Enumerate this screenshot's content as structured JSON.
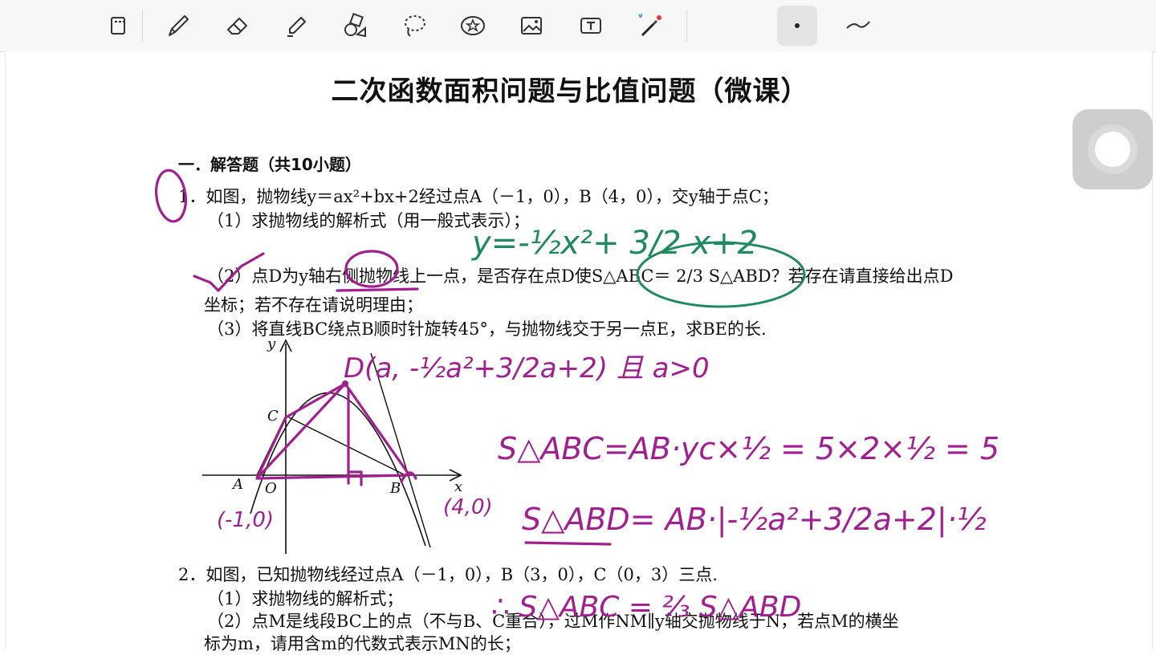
{
  "toolbar": {
    "tools": [
      {
        "name": "select-lasso-icon"
      },
      {
        "name": "pen-icon"
      },
      {
        "name": "eraser-icon"
      },
      {
        "name": "highlighter-icon"
      },
      {
        "name": "shapes-icon"
      },
      {
        "name": "lasso-icon"
      },
      {
        "name": "sticker-icon"
      },
      {
        "name": "image-icon"
      },
      {
        "name": "textbox-icon"
      },
      {
        "name": "laser-pointer-icon"
      },
      {
        "name": "dot-tool-icon"
      },
      {
        "name": "stroke-style-icon"
      }
    ],
    "active_tool": "dot-tool-icon"
  },
  "document": {
    "title": "二次函数面积问题与比值问题（微课）",
    "section": "一．解答题（共10小题）",
    "q1": {
      "stem": "1．如图，抛物线y＝ax²+bx+2经过点A（－1，0），B（4，0），交y轴于点C；",
      "p1": "（1）求抛物线的解析式（用一般式表示）；",
      "p2": "（2）点D为y轴右侧抛物线上一点，是否存在点D使S△ABC＝ 2/3 S△ABD？若存在请直接给出点D",
      "p2b": "坐标；若不存在请说明理由；",
      "p3": "（3）将直线BC绕点B顺时针旋转45°，与抛物线交于另一点E，求BE的长."
    },
    "figure": {
      "labels": {
        "y": "y",
        "x": "x",
        "C": "C",
        "A": "A",
        "O": "O",
        "B": "B"
      }
    },
    "q2": {
      "stem": "2．如图，已知抛物线经过点A（－1，0），B（3，0），C（0，3）三点.",
      "p1": "（1）求抛物线的解析式；",
      "p2": "（2）点M是线段BC上的点（不与B、C重合），过M作NM∥y轴交抛物线于N，若点M的横坐",
      "p2b": "标为m，请用含m的代数式表示MN的长；"
    }
  },
  "handwriting": {
    "answer_green": "y=-½x²+ 3/2 x+2",
    "d_point": "D(a, -½a²+3/2a+2) 且 a>0",
    "s_abc": "S△ABC=AB·yc×½ = 5×2×½ = 5",
    "s_abd": "S△ABD= AB·|-½a²+3/2a+2|·½",
    "pt_a": "(-1,0)",
    "pt_b": "(4,0)",
    "ratio": "∴ S△ABC = ⅔ S△ABD"
  },
  "colors": {
    "ink_magenta": "#a0208f",
    "ink_green": "#1f8a5e",
    "toolbar_bg": "#f7f7f7"
  }
}
